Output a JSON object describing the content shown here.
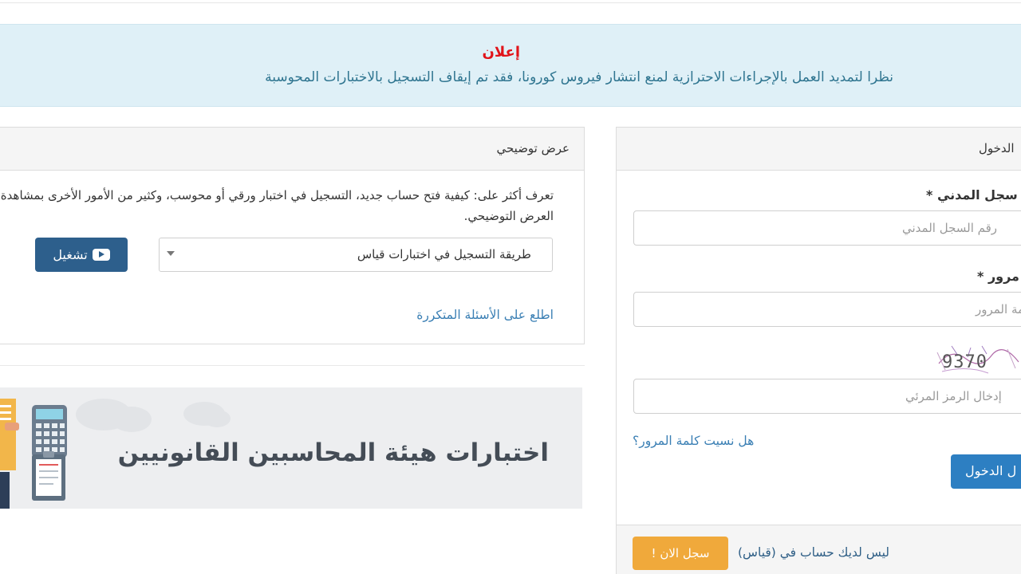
{
  "announcement": {
    "title": "إعلان",
    "text": "نظرا لتمديد العمل بالإجراءات الاحترازية لمنع انتشار فيروس كورونا، فقد تم إيقاف التسجيل بالاختبارات المحوسبة"
  },
  "demo": {
    "title": "عرض توضيحي",
    "description": "تعرف أكثر على: كيفية فتح حساب جديد، التسجيل في اختبار ورقي أو محوسب، وكثير من الأمور الأخرى بمشاهدة العرض التوضيحي.",
    "select_value": "طريقة التسجيل في اختبارات قياس",
    "play_label": "تشغيل",
    "faq_link": "اطلع على الأسئلة المتكررة"
  },
  "banner": {
    "text": "اختبارات هيئة المحاسبين القانونيين"
  },
  "login": {
    "title": "الدخول",
    "civil_label": "سجل المدني *",
    "civil_placeholder": "رقم السجل المدني",
    "password_label": "مرور *",
    "password_placeholder": "كلمة المرور",
    "captcha_value": "9370",
    "captcha_placeholder": "إدخال الرمز المرئي",
    "forgot_link": "هل نسيت كلمة المرور؟",
    "login_button": "ل الدخول",
    "no_account_text": "ليس لديك حساب في (قياس)",
    "register_button": "سجل الان !"
  },
  "colors": {
    "announcement_bg": "#dff0f7",
    "announcement_title": "#e1141a",
    "primary_button": "#2d7fc2",
    "play_button": "#2d5f8c",
    "register_button": "#f0a93b",
    "link": "#3a7fb4"
  }
}
